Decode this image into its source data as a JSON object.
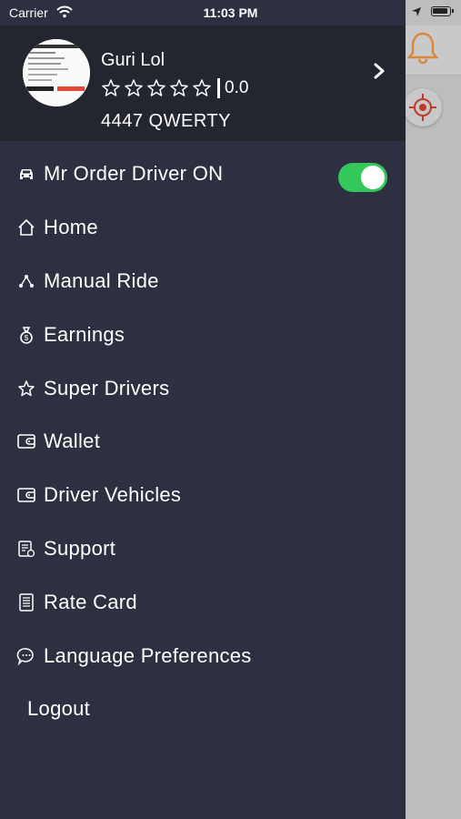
{
  "status_bar": {
    "carrier": "Carrier",
    "time": "11:03 PM"
  },
  "profile": {
    "name": "Guri Lol",
    "stars_total": 5,
    "stars_filled": 0,
    "rating": "0.0",
    "plate": "4447 QWERTY"
  },
  "driver_toggle": {
    "label": "Mr Order Driver ON",
    "on": true
  },
  "menu": [
    {
      "label": "Home",
      "icon": "home-icon"
    },
    {
      "label": "Manual Ride",
      "icon": "share-nodes-icon"
    },
    {
      "label": "Earnings",
      "icon": "money-bag-icon"
    },
    {
      "label": "Super Drivers",
      "icon": "star-icon"
    },
    {
      "label": "Wallet",
      "icon": "wallet-icon"
    },
    {
      "label": "Driver Vehicles",
      "icon": "wallet-icon"
    },
    {
      "label": "Support",
      "icon": "support-doc-icon"
    },
    {
      "label": "Rate Card",
      "icon": "rate-card-icon"
    },
    {
      "label": "Language Preferences",
      "icon": "chat-icon"
    },
    {
      "label": "Logout",
      "icon": ""
    }
  ],
  "colors": {
    "drawer_bg": "#2d3040",
    "profile_bg": "#23252f",
    "toggle_on": "#34c759",
    "accent_orange": "#e07a2a"
  }
}
